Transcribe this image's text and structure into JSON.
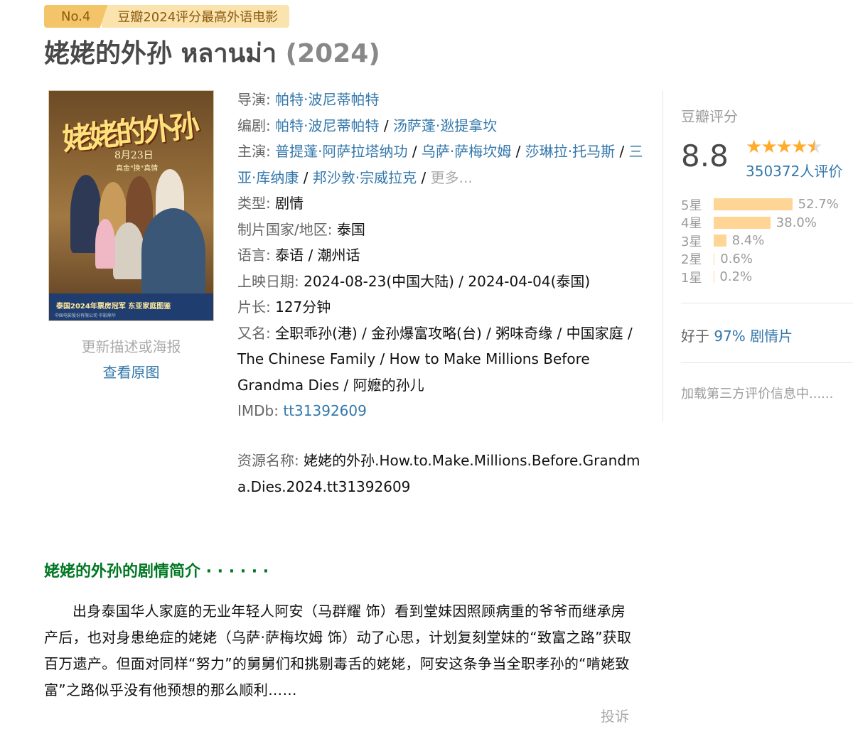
{
  "badge": {
    "rank": "No.4",
    "title": "豆瓣2024评分最高外语电影"
  },
  "movie": {
    "title_cn": "姥姥的外孙",
    "title_original": "หลานม่า",
    "year": "(2024)"
  },
  "poster": {
    "calligraphy": "姥姥的外孙",
    "date": "8月23日",
    "tagline": "真金\"换\"真情",
    "slogan": "泰国2024年票房冠军  东亚家庭图鉴",
    "credits": "中国电影股份有限公司  中影鼎华"
  },
  "poster_links": {
    "update": "更新描述或海报",
    "view_original": "查看原图"
  },
  "info": {
    "director_label": "导演:",
    "directors": [
      "帕特·波尼蒂帕特"
    ],
    "writer_label": "编剧:",
    "writers": [
      "帕特·波尼蒂帕特",
      "汤萨蓬·逖提拿坎"
    ],
    "cast_label": "主演:",
    "cast": [
      "普提蓬·阿萨拉塔纳功",
      "乌萨·萨梅坎姆",
      "莎琳拉·托马斯",
      "三亚·库纳康",
      "邦沙敦·宗威拉克"
    ],
    "cast_more": "更多...",
    "genre_label": "类型:",
    "genre": "剧情",
    "country_label": "制片国家/地区:",
    "country": "泰国",
    "language_label": "语言:",
    "language": "泰语 / 潮州话",
    "release_label": "上映日期:",
    "release": "2024-08-23(中国大陆) / 2024-04-04(泰国)",
    "runtime_label": "片长:",
    "runtime": "127分钟",
    "aka_label": "又名:",
    "aka": "全职乖孙(港) / 金孙爆富攻略(台) / 粥味奇缘 / 中国家庭 / The Chinese Family / How to Make Millions Before Grandma Dies / 阿嬷的孙儿",
    "imdb_label": "IMDb:",
    "imdb": "tt31392609"
  },
  "resource": {
    "label": "资源名称:",
    "value": "姥姥的外孙.How.to.Make.Millions.Before.Grandma.Dies.2024.tt31392609"
  },
  "rating": {
    "label": "豆瓣评分",
    "score": "8.8",
    "stars": 4.5,
    "votes": "350372人评价",
    "distribution": [
      {
        "label": "5星",
        "percent": 52.7,
        "text": "52.7%"
      },
      {
        "label": "4星",
        "percent": 38.0,
        "text": "38.0%"
      },
      {
        "label": "3星",
        "percent": 8.4,
        "text": "8.4%"
      },
      {
        "label": "2星",
        "percent": 0.6,
        "text": "0.6%"
      },
      {
        "label": "1星",
        "percent": 0.2,
        "text": "0.2%"
      }
    ],
    "better_prefix": "好于",
    "better_value": "97% 剧情片",
    "third_party": "加载第三方评价信息中......"
  },
  "synopsis": {
    "title": "姥姥的外孙的剧情简介 · · · · · ·",
    "body": "出身泰国华人家庭的无业年轻人阿安（马群耀 饰）看到堂妹因照顾病重的爷爷而继承房产后，也对身患绝症的姥姥（乌萨·萨梅坎姆 饰）动了心思，计划复刻堂妹的“致富之路”获取百万遗产。但面对同样“努力”的舅舅们和挑剔毒舌的姥姥，阿安这条争当全职孝孙的“啃姥致富”之路似乎没有他预想的那么顺利……",
    "report": "投诉"
  },
  "colors": {
    "link": "#3377aa",
    "synopsis_title": "#007722",
    "bar": "#ffd596",
    "star": "#ffac2d",
    "badge_dark": "#f4c468",
    "badge_light": "#fbe3ad"
  }
}
